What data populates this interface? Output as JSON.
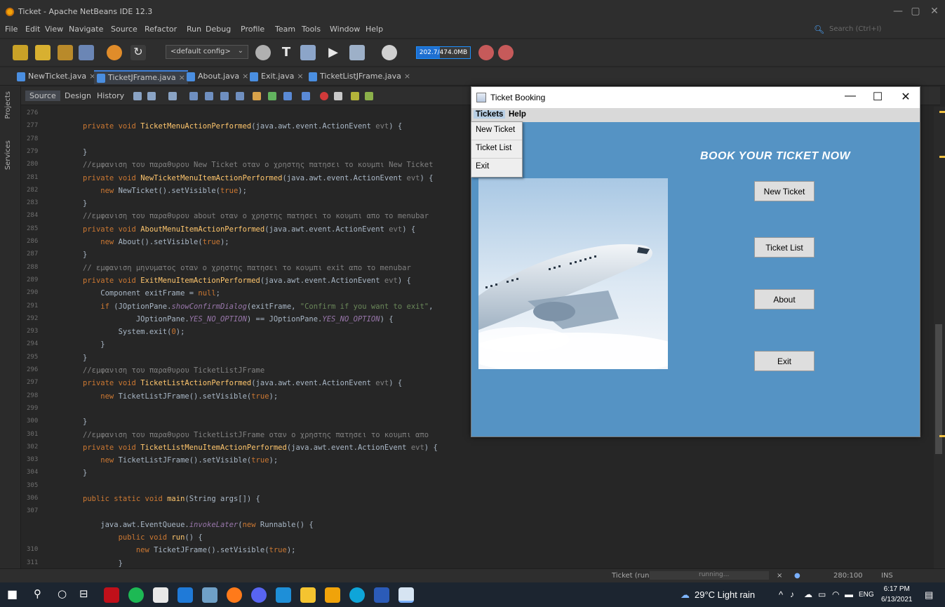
{
  "ide": {
    "title": "Ticket - Apache NetBeans IDE 12.3",
    "window_controls": {
      "minimize": "—",
      "restore": "▢",
      "close": "✕"
    },
    "menu": [
      "File",
      "Edit",
      "View",
      "Navigate",
      "Source",
      "Refactor",
      "Run",
      "Debug",
      "Profile",
      "Team",
      "Tools",
      "Window",
      "Help"
    ],
    "search_placeholder": "Search (Ctrl+I)",
    "config": "<default config>",
    "memory": "202.7/474.0MB",
    "memory_fraction": 0.43,
    "tabs": [
      "NewTicket.java",
      "TicketJFrame.java",
      "About.java",
      "Exit.java",
      "TicketListJFrame.java"
    ],
    "active_tab": 1,
    "tab_close": "×",
    "left_rail": [
      "Projects",
      "Services"
    ],
    "editor_tabs": [
      "Source",
      "Design",
      "History"
    ]
  },
  "code": {
    "line_numbers": [
      "276",
      "277",
      "278",
      "279",
      "280",
      "281",
      "282",
      "283",
      "284",
      "285",
      "286",
      "287",
      "288",
      "289",
      "290",
      "291",
      "292",
      "293",
      "294",
      "295",
      "296",
      "297",
      "298",
      "299",
      "300",
      "301",
      "302",
      "303",
      "304",
      "305",
      "306",
      "307",
      "",
      "",
      "310",
      "311"
    ],
    "lines": [
      [],
      [
        [
          "k",
          "private void "
        ],
        [
          "m",
          "TicketMenuActionPerformed"
        ],
        [
          "p",
          "(java.awt.event.ActionEvent "
        ],
        [
          "c",
          "evt"
        ],
        [
          "p",
          ") {"
        ]
      ],
      [],
      [
        [
          "p",
          "}"
        ]
      ],
      [
        [
          "c",
          "//εμφανιση του παραθυρου New Ticket οταν ο χρηστης πατησει το κουμπι New Ticket"
        ]
      ],
      [
        [
          "k",
          "private void "
        ],
        [
          "m",
          "NewTicketMenuItemActionPerformed"
        ],
        [
          "p",
          "(java.awt.event.ActionEvent "
        ],
        [
          "c",
          "evt"
        ],
        [
          "p",
          ") {"
        ]
      ],
      [
        [
          "k",
          "    new "
        ],
        [
          "p",
          "NewTicket().setVisible("
        ],
        [
          "k",
          "true"
        ],
        [
          "p",
          ");"
        ]
      ],
      [
        [
          "p",
          "}"
        ]
      ],
      [
        [
          "c",
          "//εμφανιση του παραθυρου about οταν ο χρηστης πατησει το κουμπι απο το menubar"
        ]
      ],
      [
        [
          "k",
          "private void "
        ],
        [
          "m",
          "AboutMenuItemActionPerformed"
        ],
        [
          "p",
          "(java.awt.event.ActionEvent "
        ],
        [
          "c",
          "evt"
        ],
        [
          "p",
          ") {"
        ]
      ],
      [
        [
          "k",
          "    new "
        ],
        [
          "p",
          "About().setVisible("
        ],
        [
          "k",
          "true"
        ],
        [
          "p",
          ");"
        ]
      ],
      [
        [
          "p",
          "}"
        ]
      ],
      [
        [
          "c",
          "// εμφανιση μηνυματος οταν ο χρηστης πατησει το κουμπι exit απο το menubar"
        ]
      ],
      [
        [
          "k",
          "private void "
        ],
        [
          "m",
          "ExitMenuItemActionPerformed"
        ],
        [
          "p",
          "(java.awt.event.ActionEvent "
        ],
        [
          "c",
          "evt"
        ],
        [
          "p",
          ") {"
        ]
      ],
      [
        [
          "p",
          "    Component exitFrame = "
        ],
        [
          "k",
          "null"
        ],
        [
          "p",
          ";"
        ]
      ],
      [
        [
          "k",
          "    if "
        ],
        [
          "p",
          "(JOptionPane."
        ],
        [
          "i",
          "showConfirmDialog"
        ],
        [
          "p",
          "(exitFrame, "
        ],
        [
          "s",
          "\"Confirm if you want to exit\""
        ],
        [
          "p",
          ","
        ]
      ],
      [
        [
          "p",
          "            JOptionPane."
        ],
        [
          "i",
          "YES_NO_OPTION"
        ],
        [
          "p",
          ") == JOptionPane."
        ],
        [
          "i",
          "YES_NO_OPTION"
        ],
        [
          "p",
          ") {"
        ]
      ],
      [
        [
          "p",
          "        System.exit("
        ],
        [
          "k",
          "0"
        ],
        [
          "p",
          ");"
        ]
      ],
      [
        [
          "p",
          "    }"
        ]
      ],
      [
        [
          "p",
          "}"
        ]
      ],
      [
        [
          "c",
          "//εμφανιση του παραθυρου TicketListJFrame"
        ]
      ],
      [
        [
          "k",
          "private void "
        ],
        [
          "m",
          "TicketListActionPerformed"
        ],
        [
          "p",
          "(java.awt.event.ActionEvent "
        ],
        [
          "c",
          "evt"
        ],
        [
          "p",
          ") {"
        ]
      ],
      [
        [
          "k",
          "    new "
        ],
        [
          "p",
          "TicketListJFrame().setVisible("
        ],
        [
          "k",
          "true"
        ],
        [
          "p",
          ");"
        ]
      ],
      [],
      [
        [
          "p",
          "}"
        ]
      ],
      [
        [
          "c",
          "//εμφανιση του παραθυρου TicketListJFrame οταν ο χρηστης πατησει το κουμπι απο"
        ]
      ],
      [
        [
          "k",
          "private void "
        ],
        [
          "m",
          "TicketListMenuItemActionPerformed"
        ],
        [
          "p",
          "(java.awt.event.ActionEvent "
        ],
        [
          "c",
          "evt"
        ],
        [
          "p",
          ") {"
        ]
      ],
      [
        [
          "k",
          "    new "
        ],
        [
          "p",
          "TicketListJFrame().setVisible("
        ],
        [
          "k",
          "true"
        ],
        [
          "p",
          ");"
        ]
      ],
      [
        [
          "p",
          "}"
        ]
      ],
      [],
      [
        [
          "k",
          "public static void "
        ],
        [
          "m",
          "main"
        ],
        [
          "p",
          "(String args[]) {"
        ]
      ],
      [],
      [
        [
          "p",
          "    java.awt.EventQueue."
        ],
        [
          "i",
          "invokeLater"
        ],
        [
          "p",
          "("
        ],
        [
          "k",
          "new "
        ],
        [
          "p",
          "Runnable() {"
        ]
      ],
      [
        [
          "k",
          "        public void "
        ],
        [
          "m",
          "run"
        ],
        [
          "p",
          "() {"
        ]
      ],
      [
        [
          "k",
          "            new "
        ],
        [
          "p",
          "TicketJFrame().setVisible("
        ],
        [
          "k",
          "true"
        ],
        [
          "p",
          ");"
        ]
      ],
      [
        [
          "p",
          "        }"
        ]
      ]
    ]
  },
  "swing": {
    "title": "Ticket Booking",
    "controls": {
      "minimize": "—",
      "maximize": "☐",
      "close": "✕"
    },
    "menus": [
      "Tickets",
      "Help"
    ],
    "dropdown": [
      "New Ticket",
      "Ticket List",
      "Exit"
    ],
    "headline": "BOOK YOUR TICKET NOW",
    "buttons": [
      "New Ticket",
      "Ticket List",
      "About",
      "Exit"
    ]
  },
  "status": {
    "run": "Ticket (run)",
    "progress": "running...",
    "close": "×",
    "position": "280:100",
    "mode": "INS"
  },
  "taskbar": {
    "weather": "29°C  Light rain",
    "tray_arrow": "^",
    "lang": "ENG",
    "time": "6:17 PM",
    "date": "6/13/2021"
  },
  "colors": {
    "accent": "#3d7fd8",
    "swing_bg": "#5593c4",
    "taskbar": "#1c2530"
  }
}
